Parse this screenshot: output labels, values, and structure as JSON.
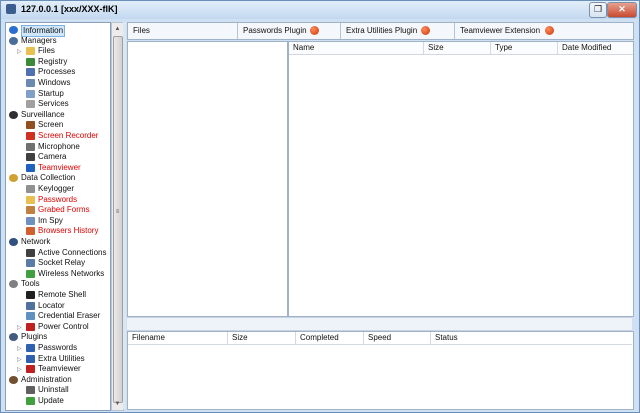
{
  "window": {
    "title": "127.0.0.1 [xxx/XXX-flK]"
  },
  "titlebar": {
    "restore_glyph": "❐",
    "close_glyph": "✕"
  },
  "tree": [
    {
      "label": "Information",
      "icon": "info-icon",
      "level": 0,
      "color": "#2a6fd0",
      "selected": true
    },
    {
      "label": "Managers",
      "icon": "managers-icon",
      "level": 0,
      "color": "#4a6e9a"
    },
    {
      "label": "Files",
      "icon": "folder-icon",
      "level": 1,
      "color": "#e8c050",
      "expander": true
    },
    {
      "label": "Registry",
      "icon": "registry-icon",
      "level": 1,
      "color": "#3a8a3a"
    },
    {
      "label": "Processes",
      "icon": "processes-icon",
      "level": 1,
      "color": "#5070b0"
    },
    {
      "label": "Windows",
      "icon": "windows-icon",
      "level": 1,
      "color": "#6a8ab0"
    },
    {
      "label": "Startup",
      "icon": "startup-icon",
      "level": 1,
      "color": "#7f9fc8"
    },
    {
      "label": "Services",
      "icon": "services-icon",
      "level": 1,
      "color": "#a0a0a0"
    },
    {
      "label": "Surveillance",
      "icon": "surveillance-icon",
      "level": 0,
      "color": "#303030"
    },
    {
      "label": "Screen",
      "icon": "screen-icon",
      "level": 1,
      "color": "#905020"
    },
    {
      "label": "Screen Recorder",
      "icon": "record-icon",
      "level": 1,
      "color": "#d03020",
      "red": true
    },
    {
      "label": "Microphone",
      "icon": "microphone-icon",
      "level": 1,
      "color": "#707070"
    },
    {
      "label": "Camera",
      "icon": "camera-icon",
      "level": 1,
      "color": "#404040"
    },
    {
      "label": "Teamviewer",
      "icon": "teamviewer-icon",
      "level": 1,
      "color": "#2060c0",
      "red": true
    },
    {
      "label": "Data Collection",
      "icon": "data-collection-icon",
      "level": 0,
      "color": "#d0a030"
    },
    {
      "label": "Keylogger",
      "icon": "keyboard-icon",
      "level": 1,
      "color": "#909090"
    },
    {
      "label": "Passwords",
      "icon": "passwords-icon",
      "level": 1,
      "color": "#e8c050",
      "red": true
    },
    {
      "label": "Grabed Forms",
      "icon": "forms-icon",
      "level": 1,
      "color": "#c08040",
      "red": true
    },
    {
      "label": "Im Spy",
      "icon": "im-spy-icon",
      "level": 1,
      "color": "#7090c0"
    },
    {
      "label": "Browsers History",
      "icon": "history-icon",
      "level": 1,
      "color": "#d06030",
      "red": true
    },
    {
      "label": "Network",
      "icon": "network-icon",
      "level": 0,
      "color": "#305080"
    },
    {
      "label": "Active Connections",
      "icon": "globe-icon",
      "level": 1,
      "color": "#404040"
    },
    {
      "label": "Socket Relay",
      "icon": "relay-icon",
      "level": 1,
      "color": "#5a7aa8"
    },
    {
      "label": "Wireless Networks",
      "icon": "wireless-icon",
      "level": 1,
      "color": "#40a040"
    },
    {
      "label": "Tools",
      "icon": "tools-icon",
      "level": 0,
      "color": "#808080"
    },
    {
      "label": "Remote Shell",
      "icon": "shell-icon",
      "level": 1,
      "color": "#202020"
    },
    {
      "label": "Locator",
      "icon": "locator-icon",
      "level": 1,
      "color": "#5070a0"
    },
    {
      "label": "Credential Eraser",
      "icon": "eraser-icon",
      "level": 1,
      "color": "#6090c0"
    },
    {
      "label": "Power Control",
      "icon": "power-icon",
      "level": 1,
      "color": "#c02020",
      "expander": true
    },
    {
      "label": "Plugins",
      "icon": "plugins-icon",
      "level": 0,
      "color": "#405a80"
    },
    {
      "label": "Passwords",
      "icon": "plugin-passwords-icon",
      "level": 1,
      "color": "#3060b0",
      "expander": true
    },
    {
      "label": "Extra Utilities",
      "icon": "plugin-utilities-icon",
      "level": 1,
      "color": "#3060b0",
      "expander": true
    },
    {
      "label": "Teamviewer",
      "icon": "plugin-teamviewer-icon",
      "level": 1,
      "color": "#c02020",
      "expander": true
    },
    {
      "label": "Administration",
      "icon": "administration-icon",
      "level": 0,
      "color": "#705030"
    },
    {
      "label": "Uninstall",
      "icon": "uninstall-icon",
      "level": 1,
      "color": "#606060"
    },
    {
      "label": "Update",
      "icon": "update-icon",
      "level": 1,
      "color": "#40a040"
    }
  ],
  "tabs": [
    {
      "label": "Files",
      "has_indicator": false
    },
    {
      "label": "Passwords Plugin",
      "has_indicator": true
    },
    {
      "label": "Extra Utilities Plugin",
      "has_indicator": true
    },
    {
      "label": "Teamviewer Extension",
      "has_indicator": true
    }
  ],
  "files_grid": {
    "columns": [
      "Name",
      "Size",
      "Type",
      "Date Modified"
    ]
  },
  "transfers_grid": {
    "columns": [
      "Filename",
      "Size",
      "Completed",
      "Speed",
      "Status"
    ]
  },
  "scrollbar": {
    "up_glyph": "▲",
    "down_glyph": "▼",
    "grip_glyph": "≡"
  }
}
